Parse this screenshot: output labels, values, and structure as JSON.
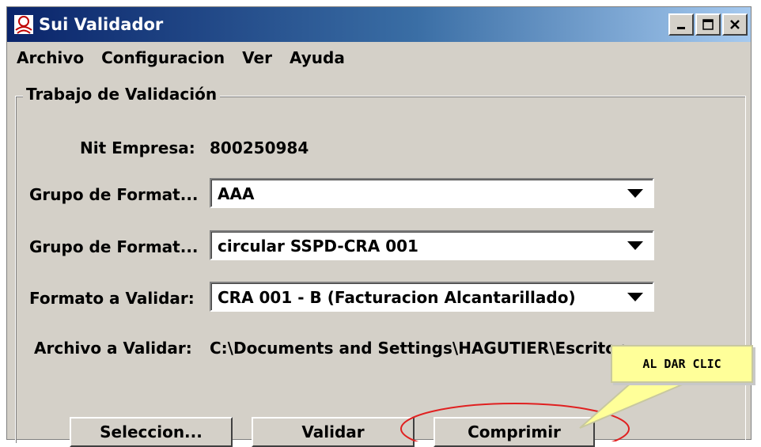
{
  "window": {
    "title": "Sui Validador"
  },
  "menu": [
    "Archivo",
    "Configuracion",
    "Ver",
    "Ayuda"
  ],
  "group": {
    "title": "Trabajo de Validación",
    "nit_label": "Nit Empresa:",
    "nit_value": "800250984",
    "grupo1_label": "Grupo de Format...",
    "grupo1_value": "AAA",
    "grupo2_label": "Grupo de Format...",
    "grupo2_value": "circular SSPD-CRA 001",
    "formato_label": "Formato a Validar:",
    "formato_value": "CRA 001 - B (Facturacion Alcantarillado)",
    "archivo_label": "Archivo a Validar:",
    "archivo_value": "C:\\Documents and Settings\\HAGUTIER\\Escritor..."
  },
  "buttons": {
    "seleccion": "Seleccion...",
    "validar": "Validar",
    "comprimir": "Comprimir"
  },
  "callout": {
    "text": "AL DAR CLIC"
  },
  "colors": {
    "titlebar_start": "#0a246a",
    "titlebar_end": "#a6caf0",
    "callout_bg": "#ffff99",
    "highlight_ring": "#e02020"
  }
}
